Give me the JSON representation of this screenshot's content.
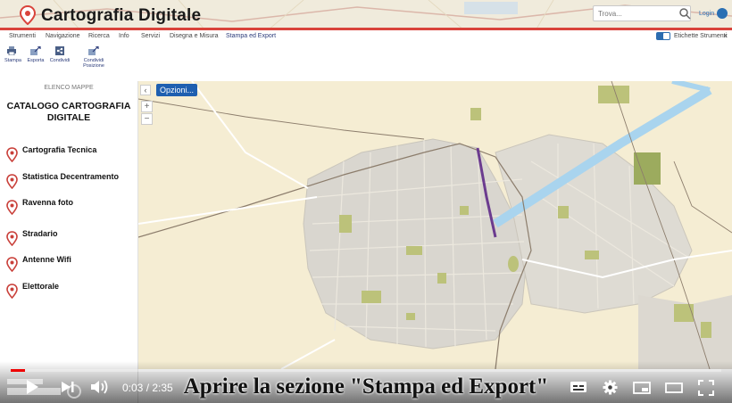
{
  "header": {
    "app_title": "Cartografia Digitale",
    "search_placeholder": "Trova...",
    "user_link": "Login"
  },
  "menu": {
    "items": [
      "Strumenti",
      "Navigazione",
      "Ricerca",
      "Info",
      "Servizi",
      "Disegna e Misura",
      "Stampa ed Export"
    ],
    "active_index": 6,
    "toggle_label": "Etichette Strumenti",
    "close_glyph": "×"
  },
  "toolbar": {
    "tools": [
      {
        "label": "Stampa",
        "icon": "printer-icon"
      },
      {
        "label": "Esporta",
        "icon": "export-icon"
      },
      {
        "label": "Condividi",
        "icon": "share-icon"
      },
      {
        "label": "Condividi Posizione",
        "icon": "share-position-icon"
      }
    ]
  },
  "sidebar": {
    "header": "ELENCO MAPPE",
    "title": "CATALOGO CARTOGRAFIA DIGITALE",
    "items": [
      {
        "label": "Cartografia Tecnica"
      },
      {
        "label": "Statistica Decentramento"
      },
      {
        "label": "Ravenna foto"
      },
      {
        "label": "Stradario"
      },
      {
        "label": "Antenne Wifi"
      },
      {
        "label": "Elettorale"
      }
    ]
  },
  "map": {
    "options_button": "Opzioni...",
    "collapse_glyph": "‹",
    "zoom_in": "+",
    "zoom_out": "−"
  },
  "video": {
    "caption": "Aprire la sezione \"Stampa ed Export\"",
    "current_time": "0:03",
    "duration": "2:35",
    "progress": 0.02
  },
  "colors": {
    "header_accent": "#d9433b",
    "menu_active": "#2b3b7a",
    "options_button": "#1e5fb0",
    "progress": "#e00000"
  }
}
